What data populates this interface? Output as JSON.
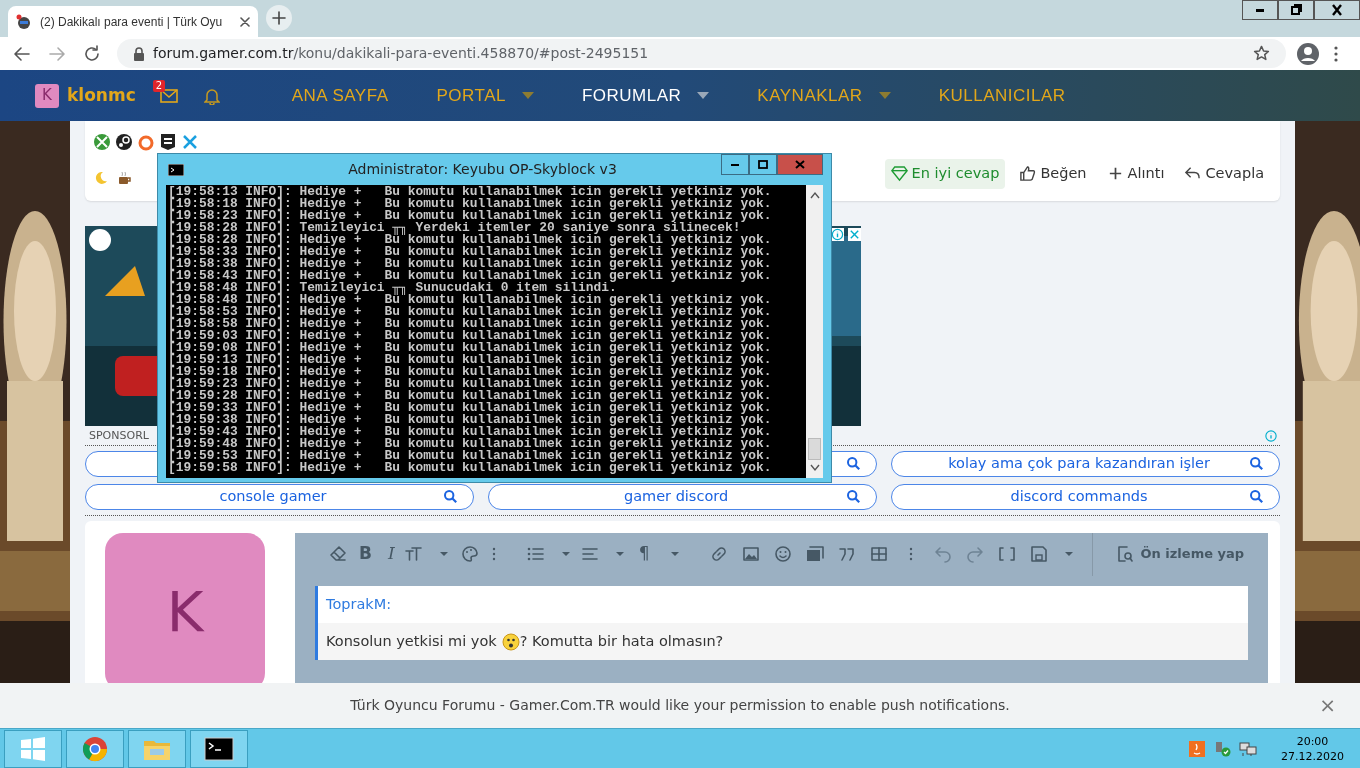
{
  "browser": {
    "tab_title": "(2) Dakikalı para eventi | Türk Oyu",
    "url_host": "forum.gamer.com.tr",
    "url_path": "/konu/dakikali-para-eventi.458870/#post-2495151"
  },
  "nav": {
    "avatar_letter": "K",
    "username": "klonmc",
    "mail_badge": "2",
    "items": [
      {
        "label": "ANA SAYFA",
        "selected": false,
        "dropdown": false
      },
      {
        "label": "PORTAL",
        "selected": false,
        "dropdown": true
      },
      {
        "label": "FORUMLAR",
        "selected": true,
        "dropdown": true
      },
      {
        "label": "KAYNAKLAR",
        "selected": false,
        "dropdown": true
      },
      {
        "label": "KULLANICILAR",
        "selected": false,
        "dropdown": false
      }
    ]
  },
  "post_actions": [
    {
      "kind": "best",
      "label": "En iyi cevap"
    },
    {
      "kind": "like",
      "label": "Beğen"
    },
    {
      "kind": "quote",
      "label": "Alıntı"
    },
    {
      "kind": "reply",
      "label": "Cevapla"
    }
  ],
  "sponsor_label": "SPONSORL",
  "searches": [
    {
      "kind": "covered",
      "search_icon": false
    },
    {
      "kind": "covered",
      "search_icon": true
    },
    {
      "kind": "text",
      "label": "kolay ama çok para kazandıran işler",
      "search_icon": true
    },
    {
      "kind": "text",
      "label": "console gamer",
      "search_icon": true
    },
    {
      "kind": "text",
      "label": "gamer discord",
      "search_icon": true
    },
    {
      "kind": "text",
      "label": "discord commands",
      "search_icon": true
    }
  ],
  "reply": {
    "avatar_letter": "K",
    "bold_label": "B",
    "italic_label": "I",
    "para_label": "¶",
    "preview_button": "Ön izleme yap",
    "quote_author": "ToprakM:",
    "quote_before": "Konsolun yetkisi mi yok",
    "quote_after": "? Komutta bir hata olmasın?"
  },
  "notification": {
    "text": "Türk Oyuncu Forumu - Gamer.Com.TR would like your permission to enable push notifications.",
    "close": "×"
  },
  "console": {
    "title": "Administrator:  Keyubu OP-Skyblock v3",
    "lines": [
      "[19:58:13 INFO]: Hediye +   Bu komutu kullanabilmek icin gerekli yetkiniz yok.",
      "[19:58:18 INFO]: Hediye +   Bu komutu kullanabilmek icin gerekli yetkiniz yok.",
      "[19:58:23 INFO]: Hediye +   Bu komutu kullanabilmek icin gerekli yetkiniz yok.",
      "[19:58:28 INFO]: Temizleyici ╥╖ Yerdeki itemler 20 saniye sonra silinecek!",
      "[19:58:28 INFO]: Hediye +   Bu komutu kullanabilmek icin gerekli yetkiniz yok.",
      "[19:58:33 INFO]: Hediye +   Bu komutu kullanabilmek icin gerekli yetkiniz yok.",
      "[19:58:38 INFO]: Hediye +   Bu komutu kullanabilmek icin gerekli yetkiniz yok.",
      "[19:58:43 INFO]: Hediye +   Bu komutu kullanabilmek icin gerekli yetkiniz yok.",
      "[19:58:48 INFO]: Temizleyici ╥╖ Sunucudaki 0 item silindi.",
      "[19:58:48 INFO]: Hediye +   Bu komutu kullanabilmek icin gerekli yetkiniz yok.",
      "[19:58:53 INFO]: Hediye +   Bu komutu kullanabilmek icin gerekli yetkiniz yok.",
      "[19:58:58 INFO]: Hediye +   Bu komutu kullanabilmek icin gerekli yetkiniz yok.",
      "[19:59:03 INFO]: Hediye +   Bu komutu kullanabilmek icin gerekli yetkiniz yok.",
      "[19:59:08 INFO]: Hediye +   Bu komutu kullanabilmek icin gerekli yetkiniz yok.",
      "[19:59:13 INFO]: Hediye +   Bu komutu kullanabilmek icin gerekli yetkiniz yok.",
      "[19:59:18 INFO]: Hediye +   Bu komutu kullanabilmek icin gerekli yetkiniz yok.",
      "[19:59:23 INFO]: Hediye +   Bu komutu kullanabilmek icin gerekli yetkiniz yok.",
      "[19:59:28 INFO]: Hediye +   Bu komutu kullanabilmek icin gerekli yetkiniz yok.",
      "[19:59:33 INFO]: Hediye +   Bu komutu kullanabilmek icin gerekli yetkiniz yok.",
      "[19:59:38 INFO]: Hediye +   Bu komutu kullanabilmek icin gerekli yetkiniz yok.",
      "[19:59:43 INFO]: Hediye +   Bu komutu kullanabilmek icin gerekli yetkiniz yok.",
      "[19:59:48 INFO]: Hediye +   Bu komutu kullanabilmek icin gerekli yetkiniz yok.",
      "[19:59:53 INFO]: Hediye +   Bu komutu kullanabilmek icin gerekli yetkiniz yok.",
      "[19:59:58 INFO]: Hediye +   Bu komutu kullanabilmek icin gerekli yetkiniz yok."
    ]
  },
  "taskbar": {
    "time": "20:00",
    "date": "27.12.2020"
  }
}
